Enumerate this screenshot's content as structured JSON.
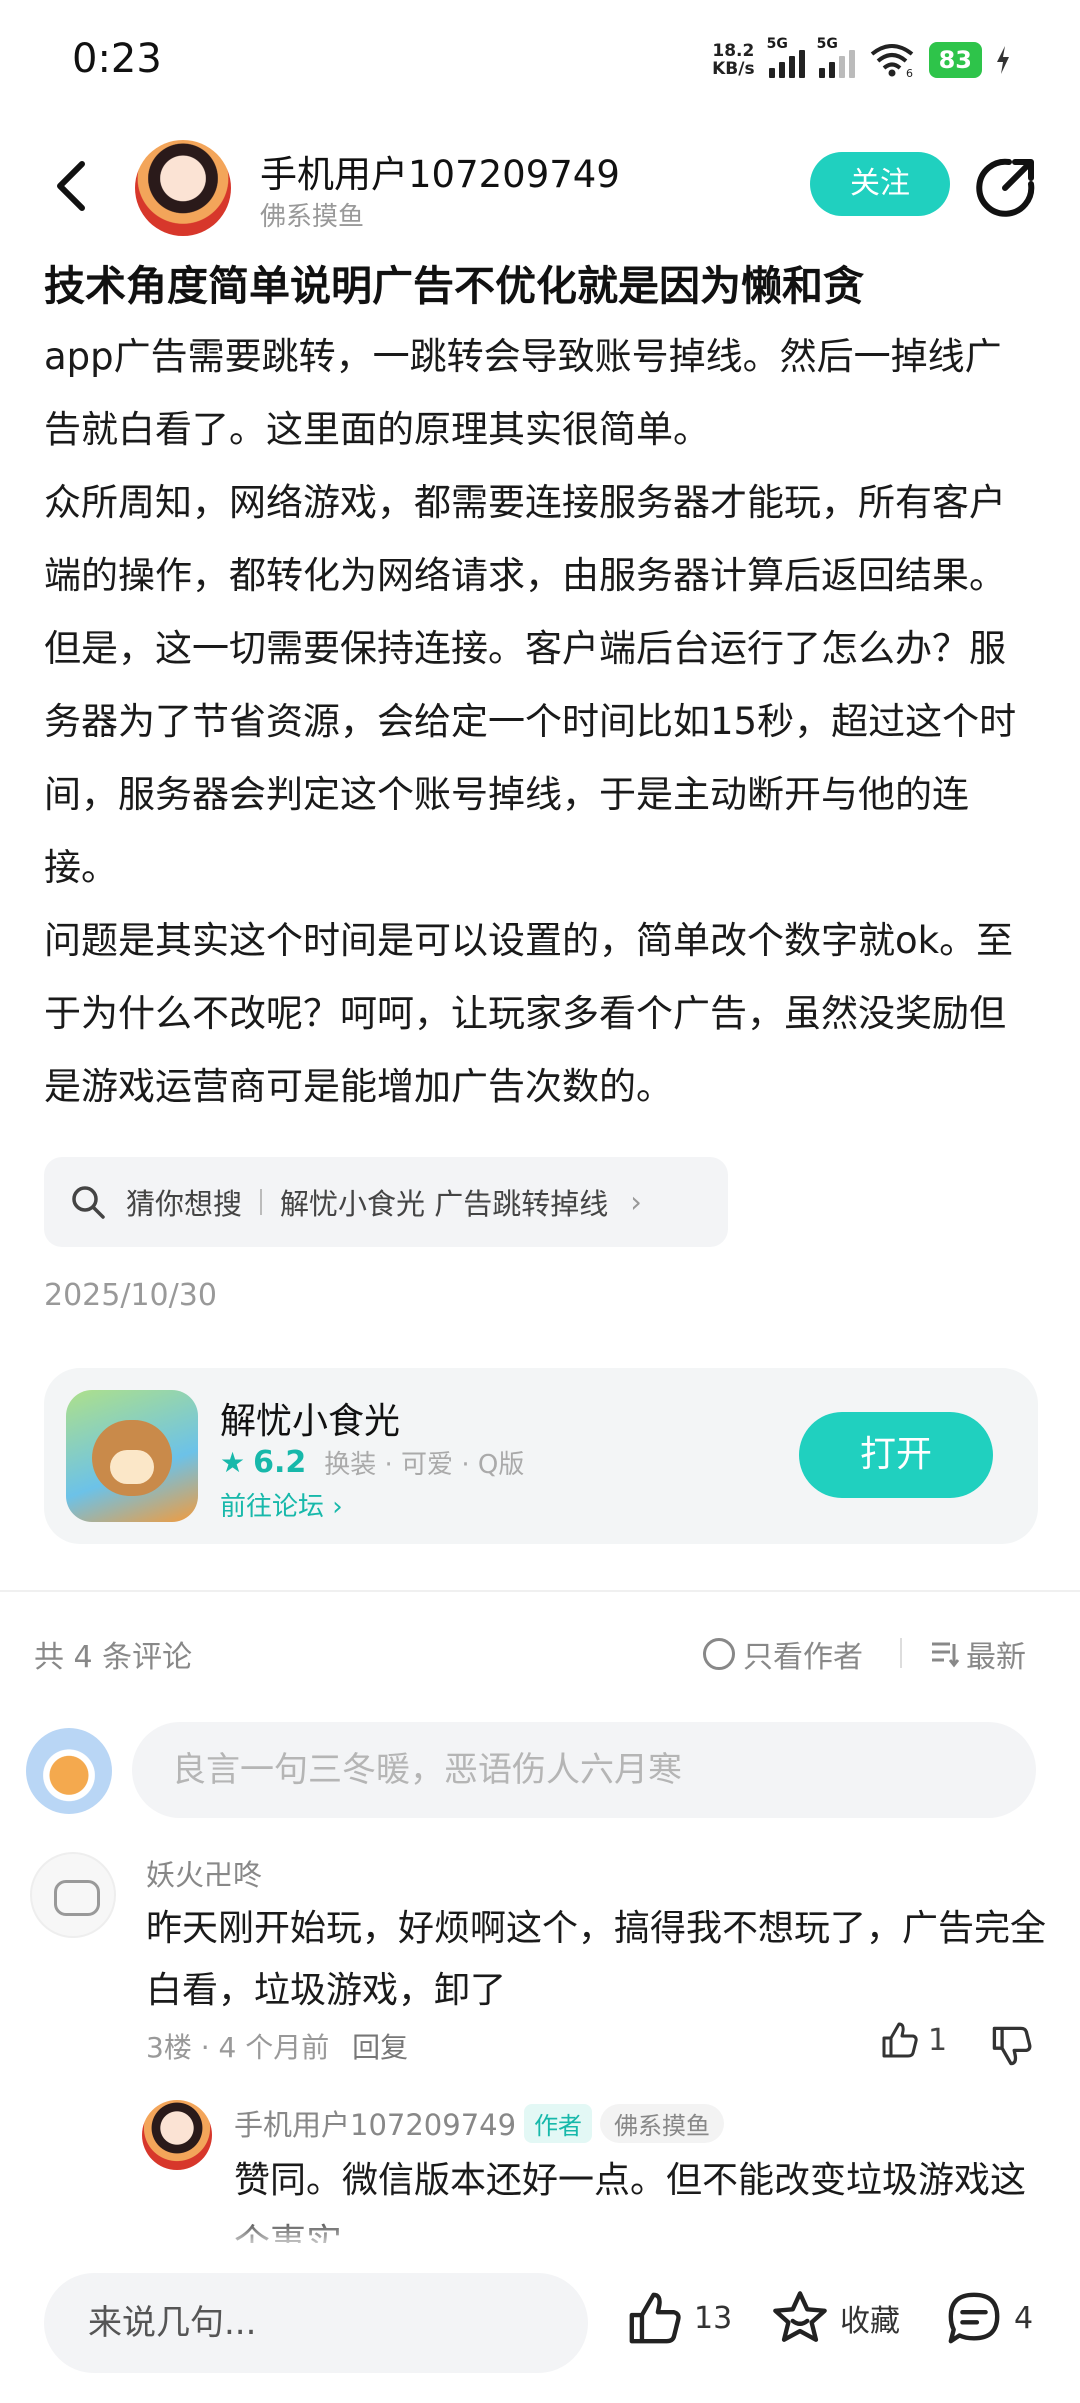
{
  "status": {
    "time": "0:23",
    "net_speed_top": "18.2",
    "net_speed_bottom": "KB/s",
    "sig1": "5G",
    "sig2": "5G",
    "wifi_badge": "6",
    "battery": "83"
  },
  "header": {
    "user_name": "手机用户107209749",
    "user_tag": "佛系摸鱼",
    "follow_label": "关注"
  },
  "article": {
    "title": "技术角度简单说明广告不优化就是因为懒和贪",
    "paragraphs": [
      "app广告需要跳转，一跳转会导致账号掉线。然后一掉线广告就白看了。这里面的原理其实很简单。",
      "众所周知，网络游戏，都需要连接服务器才能玩，所有客户端的操作，都转化为网络请求，由服务器计算后返回结果。但是，这一切需要保持连接。客户端后台运行了怎么办？服务器为了节省资源，会给定一个时间比如15秒，超过这个时间，服务器会判定这个账号掉线，于是主动断开与他的连接。",
      "问题是其实这个时间是可以设置的，简单改个数字就ok。至于为什么不改呢？呵呵，让玩家多看个广告，虽然没奖励但是游戏运营商可是能增加广告次数的。"
    ],
    "search_prefix": "猜你想搜",
    "search_query": "解忧小食光 广告跳转掉线",
    "date": "2025/10/30"
  },
  "game": {
    "name": "解忧小食光",
    "score": "6.2",
    "tags": "换装 · 可爱 · Q版",
    "forum_link": "前往论坛",
    "open_label": "打开"
  },
  "comments": {
    "count_label": "共 4 条评论",
    "author_only_label": "只看作者",
    "sort_label": "最新",
    "input_placeholder": "良言一句三冬暖，恶语伤人六月寒",
    "items": [
      {
        "user": "妖火卍咚",
        "text": "昨天刚开始玩，好烦啊这个，搞得我不想玩了，广告完全白看，垃圾游戏，卸了",
        "meta": "3楼 · 4 个月前",
        "reply_label": "回复",
        "likes": "1",
        "reply": {
          "user": "手机用户107209749",
          "author_badge": "作者",
          "tag": "佛系摸鱼",
          "text": "赞同。微信版本还好一点。但不能改变垃圾游戏这个事实"
        }
      }
    ]
  },
  "bottom_bar": {
    "input_placeholder": "来说几句...",
    "like_count": "13",
    "collect_label": "收藏",
    "comment_count": "4"
  },
  "colors": {
    "accent": "#20d0bf",
    "accent_text": "#17b8aa",
    "battery": "#2ec44a"
  }
}
